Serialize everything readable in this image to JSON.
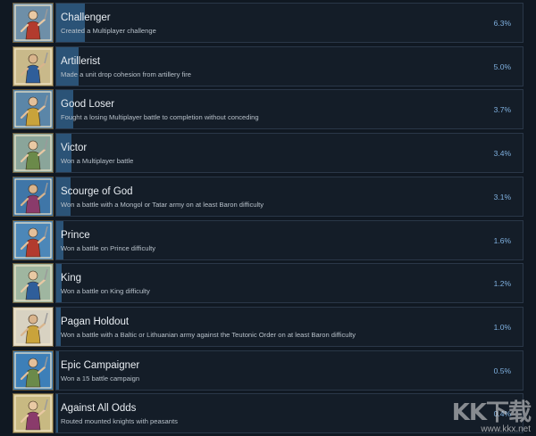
{
  "achievements": [
    {
      "title": "Challenger",
      "description": "Created a Multiplayer challenge",
      "percent": "6.3%",
      "fill": 6.3,
      "icon": "medieval-challenger-icon",
      "bg": "#6e8fa8"
    },
    {
      "title": "Artillerist",
      "description": "Made a unit drop cohesion from artillery fire",
      "percent": "5.0%",
      "fill": 5.0,
      "icon": "medieval-artillerist-icon",
      "bg": "#c9b98a"
    },
    {
      "title": "Good Loser",
      "description": "Fought a losing Multiplayer battle to completion without conceding",
      "percent": "3.7%",
      "fill": 3.7,
      "icon": "medieval-good-loser-icon",
      "bg": "#5b86a8"
    },
    {
      "title": "Victor",
      "description": "Won a Multiplayer battle",
      "percent": "3.4%",
      "fill": 3.4,
      "icon": "medieval-victor-icon",
      "bg": "#8aa59a"
    },
    {
      "title": "Scourge of God",
      "description": "Won a battle with a Mongol or Tatar army on at least Baron difficulty",
      "percent": "3.1%",
      "fill": 3.1,
      "icon": "medieval-scourge-icon",
      "bg": "#3f76a8"
    },
    {
      "title": "Prince",
      "description": "Won a battle on Prince difficulty",
      "percent": "1.6%",
      "fill": 1.6,
      "icon": "medieval-prince-icon",
      "bg": "#4c87b8"
    },
    {
      "title": "King",
      "description": "Won a battle on King difficulty",
      "percent": "1.2%",
      "fill": 1.2,
      "icon": "medieval-king-icon",
      "bg": "#9fb6a0"
    },
    {
      "title": "Pagan Holdout",
      "description": "Won a battle with a Baltic or Lithuanian army against the Teutonic Order on at least Baron difficulty",
      "percent": "1.0%",
      "fill": 1.0,
      "icon": "medieval-pagan-holdout-icon",
      "bg": "#d8d2c2"
    },
    {
      "title": "Epic Campaigner",
      "description": "Won a 15 battle campaign",
      "percent": "0.5%",
      "fill": 0.5,
      "icon": "medieval-epic-campaigner-icon",
      "bg": "#3d7fb8"
    },
    {
      "title": "Against All Odds",
      "description": "Routed mounted knights with peasants",
      "percent": "0.4%",
      "fill": 0.4,
      "icon": "medieval-against-all-odds-icon",
      "bg": "#c8b982"
    }
  ],
  "watermark": {
    "logo": "KK下载",
    "url": "www.kkx.net"
  }
}
